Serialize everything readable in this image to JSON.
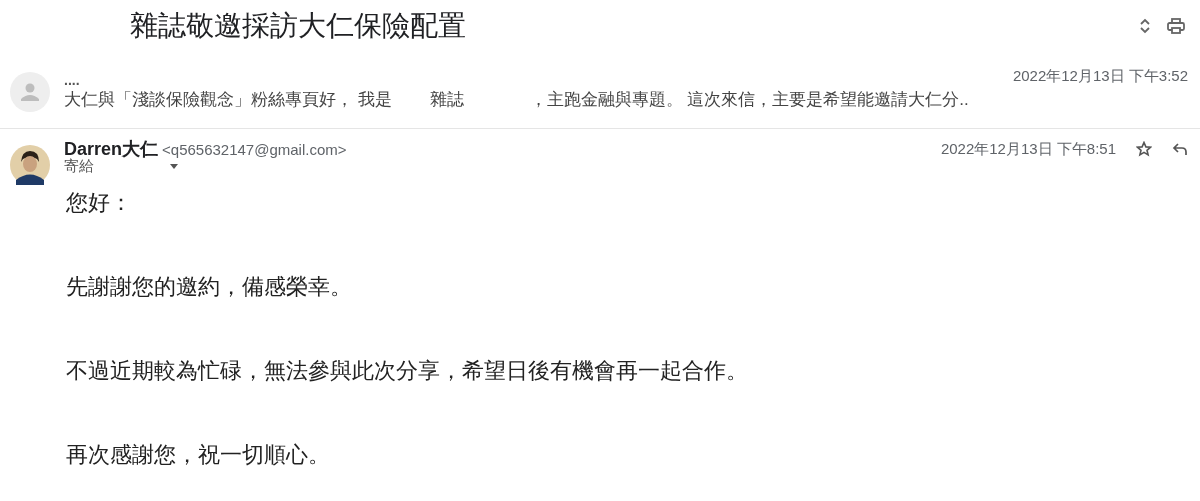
{
  "subject": "雜誌敬邀採訪大仁保險配置",
  "messages": [
    {
      "kind": "collapsed",
      "sender": "....",
      "date": "2022年12月13日 下午3:52",
      "preview": "大仁與「淺談保險觀念」粉絲專頁好， 我是        雜誌              ，主跑金融與專題。 這次來信，主要是希望能邀請大仁分.."
    },
    {
      "kind": "expanded",
      "sender": "Darren大仁",
      "email": "<q565632147@gmail.com>",
      "to_label": "寄給",
      "date": "2022年12月13日 下午8:51",
      "starred": false,
      "body": [
        "您好：",
        "先謝謝您的邀約，備感榮幸。",
        "不過近期較為忙碌，無法參與此次分享，希望日後有機會再一起合作。",
        "再次感謝您，祝一切順心。"
      ]
    }
  ]
}
